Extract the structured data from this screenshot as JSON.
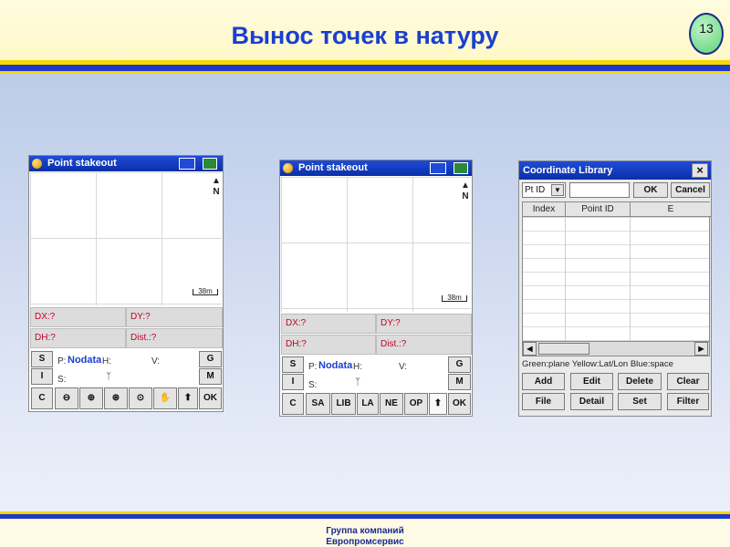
{
  "slide": {
    "title": "Вынос точек в натуру",
    "page_number": "13",
    "footer_line1": "Группа компаний",
    "footer_line2": "Европромсервис"
  },
  "screen1": {
    "window_title": "Point stakeout",
    "north_label": "N",
    "scale_label": "38m",
    "fields": {
      "dx": "DX:?",
      "dy": "DY:?",
      "dh": "DH:?",
      "dist": "Dist.:?"
    },
    "side_left": [
      "S",
      "I",
      "C"
    ],
    "side_right": [
      "G",
      "M"
    ],
    "info": {
      "p_label": "P:",
      "p_value": "Nodata",
      "h_label": "H:",
      "v_label": "V:",
      "s_label": "S:"
    },
    "toolbar_icons": [
      "zoom-out-icon",
      "zoom-in-icon",
      "zoom-all-icon",
      "zoom-window-icon",
      "pan-hand-icon",
      "up-arrow-icon"
    ],
    "ok_label": "OK"
  },
  "screen2": {
    "window_title": "Point stakeout",
    "north_label": "N",
    "scale_label": "38m",
    "fields": {
      "dx": "DX:?",
      "dy": "DY:?",
      "dh": "DH:?",
      "dist": "Dist.:?"
    },
    "side_left": [
      "S",
      "I",
      "C"
    ],
    "side_right": [
      "G",
      "M"
    ],
    "info": {
      "p_label": "P:",
      "p_value": "Nodata",
      "h_label": "H:",
      "v_label": "V:",
      "s_label": "S:"
    },
    "toolbar": [
      "SA",
      "LIB",
      "LA",
      "NE",
      "OP"
    ],
    "ok_label": "OK"
  },
  "coord_library": {
    "window_title": "Coordinate Library",
    "close_label": "×",
    "filter_select": "Pt ID",
    "ok_label": "OK",
    "cancel_label": "Cancel",
    "columns": [
      "Index",
      "Point ID",
      "E"
    ],
    "legend": "Green:plane Yellow:Lat/Lon  Blue:space",
    "buttons_row1": [
      "Add",
      "Edit",
      "Delete",
      "Clear"
    ],
    "buttons_row2": [
      "File",
      "Detail",
      "Set",
      "Filter"
    ]
  },
  "colors": {
    "title_blue": "#1a3fd0",
    "stripe_yellow": "#f5d800",
    "stripe_blue": "#1f39c8",
    "field_red": "#c0002a"
  }
}
